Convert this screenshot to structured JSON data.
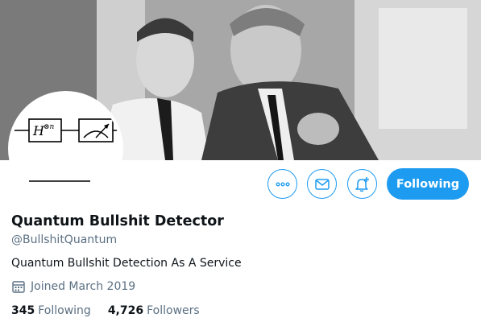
{
  "profile": {
    "display_name": "Quantum Bullshit Detector",
    "handle": "@BullshitQuantum",
    "bio": "Quantum Bullshit Detection As A Service",
    "joined": "Joined March 2019"
  },
  "avatar": {
    "gate_label": "H",
    "gate_superscript": "⊗n"
  },
  "actions": {
    "more_icon": "more-icon",
    "message_icon": "mail-icon",
    "notify_icon": "bell-plus-icon",
    "follow_label": "Following"
  },
  "stats": {
    "following_count": "345",
    "following_label": "Following",
    "followers_count": "4,726",
    "followers_label": "Followers"
  },
  "colors": {
    "accent": "#1d9bf0",
    "secondary_text": "#5b7083",
    "primary_text": "#0f1419"
  }
}
